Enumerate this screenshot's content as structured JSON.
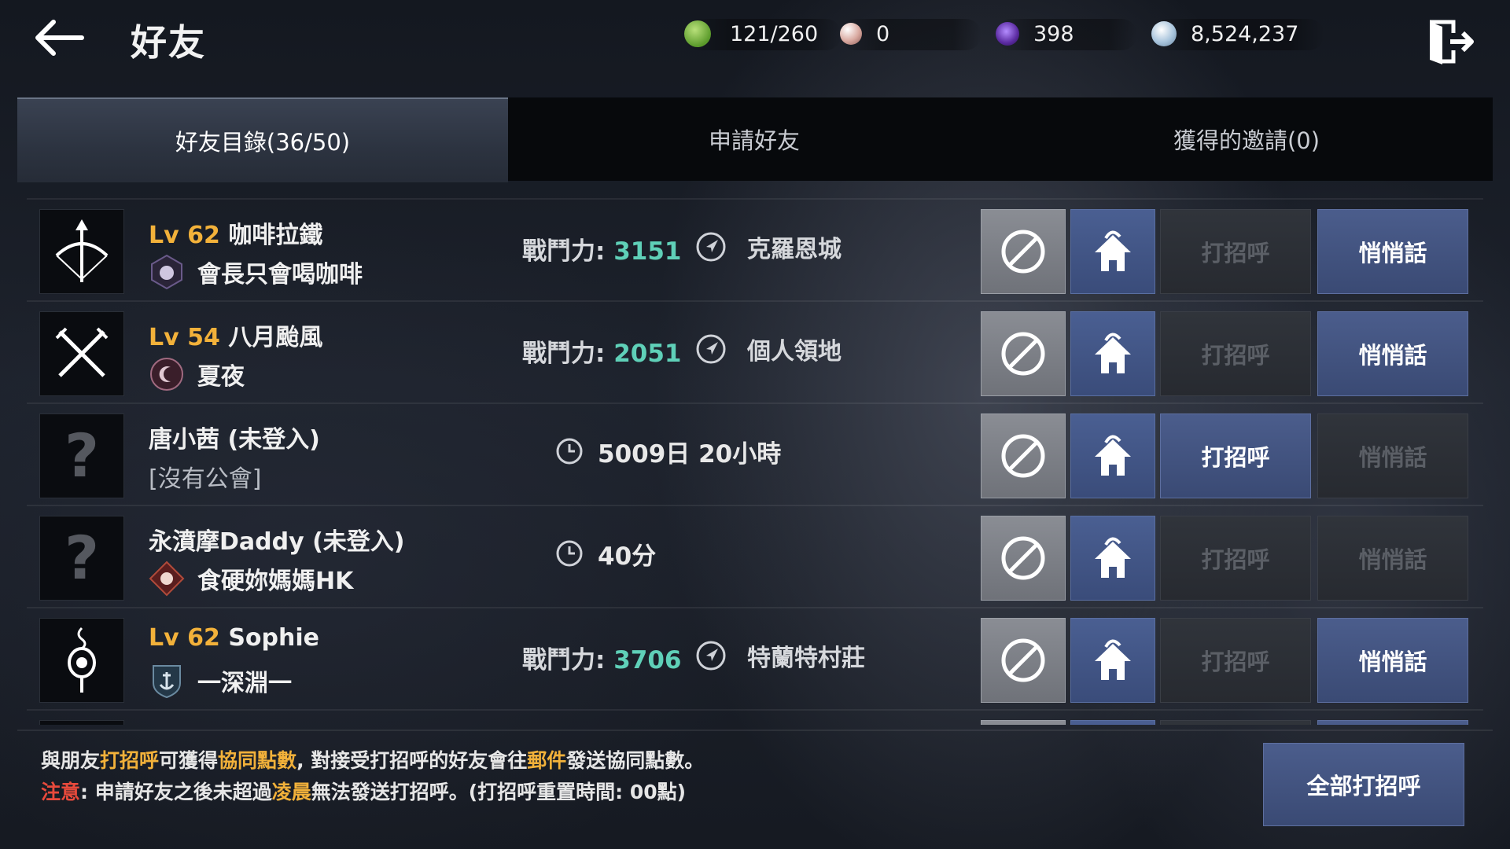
{
  "header": {
    "title": "好友",
    "currencies": [
      {
        "icon": "stamina-leaf-icon",
        "value": "121/260"
      },
      {
        "icon": "pearl-icon",
        "value": "0"
      },
      {
        "icon": "purple-gem-icon",
        "value": "398"
      },
      {
        "icon": "silver-coin-icon",
        "value": "8,524,237"
      }
    ]
  },
  "tabs": [
    {
      "label": "好友目錄(36/50)",
      "active": true
    },
    {
      "label": "申請好友",
      "active": false
    },
    {
      "label": "獲得的邀請(0)",
      "active": false
    }
  ],
  "friends": [
    {
      "level": "Lv 62",
      "name": "咖啡拉鐵",
      "guild": "會長只會喝咖啡",
      "power_label": "戰鬥力:",
      "power": "3151",
      "location": "克羅恩城",
      "greet_label": "打招呼",
      "greet_enabled": false,
      "whisper_label": "悄悄話",
      "whisper_enabled": true,
      "avatar": "bow-class-icon"
    },
    {
      "level": "Lv 54",
      "name": "八月颱風",
      "guild": "夏夜",
      "power_label": "戰鬥力:",
      "power": "2051",
      "location": "個人領地",
      "greet_label": "打招呼",
      "greet_enabled": false,
      "whisper_label": "悄悄話",
      "whisper_enabled": true,
      "avatar": "crossed-blades-class-icon"
    },
    {
      "name": "唐小茜 (未登入)",
      "guild_none": "[沒有公會]",
      "offline": "5009日 20小時",
      "greet_label": "打招呼",
      "greet_enabled": true,
      "whisper_label": "悄悄話",
      "whisper_enabled": false,
      "avatar": "unknown-class-icon"
    },
    {
      "name": "永濆摩Daddy (未登入)",
      "guild": "食硬妳媽媽HK",
      "offline": "40分",
      "greet_label": "打招呼",
      "greet_enabled": false,
      "whisper_label": "悄悄話",
      "whisper_enabled": false,
      "avatar": "unknown-class-icon"
    },
    {
      "level": "Lv 62",
      "name": "Sophie",
      "guild": "一深淵一",
      "power_label": "戰鬥力:",
      "power": "3706",
      "location": "特蘭特村莊",
      "greet_label": "打招呼",
      "greet_enabled": false,
      "whisper_label": "悄悄話",
      "whisper_enabled": true,
      "avatar": "orb-staff-class-icon"
    }
  ],
  "footer": {
    "line1": [
      {
        "t": "與朋友",
        "c": ""
      },
      {
        "t": "打招呼",
        "c": "y"
      },
      {
        "t": "可獲得",
        "c": ""
      },
      {
        "t": "協同點數",
        "c": "y"
      },
      {
        "t": ", 對接受打招呼的好友會往",
        "c": ""
      },
      {
        "t": "郵件",
        "c": "y"
      },
      {
        "t": "發送協同點數。",
        "c": ""
      }
    ],
    "line2": [
      {
        "t": "注意",
        "c": "r"
      },
      {
        "t": ": 申請好友之後未超過",
        "c": ""
      },
      {
        "t": "凌晨",
        "c": "y"
      },
      {
        "t": "無法發送打招呼。(打招呼重置時間: 00點)",
        "c": ""
      }
    ],
    "greet_all_label": "全部打招呼"
  },
  "colors": {
    "accent_gold": "#f2b13a",
    "power_teal": "#5fd0b8",
    "warning_red": "#e84a3c",
    "button_blue": "#4b5d8c"
  }
}
